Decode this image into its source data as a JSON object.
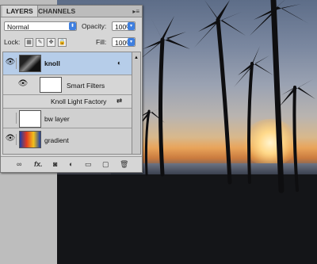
{
  "panel": {
    "tabs": [
      "LAYERS",
      "CHANNELS"
    ],
    "blend_mode": "Normal",
    "opacity_label": "Opacity:",
    "opacity_value": "100%",
    "lock_label": "Lock:",
    "fill_label": "Fill:",
    "fill_value": "100%"
  },
  "layers": [
    {
      "name": "knoll",
      "visible": true,
      "selected": true,
      "smart_object": true
    },
    {
      "name": "Smart Filters",
      "visible": true,
      "is_filter_group": true
    },
    {
      "name": "Knoll Light Factory",
      "is_filter": true
    },
    {
      "name": "bw layer",
      "visible": false
    },
    {
      "name": "gradient",
      "visible": true
    }
  ],
  "footer_icons": [
    "link-icon",
    "fx-icon",
    "mask-icon",
    "adjustment-icon",
    "group-icon",
    "new-layer-icon",
    "trash-icon"
  ],
  "colors": {
    "selection": "#b6cde9",
    "accent": "#3e7fe0"
  }
}
